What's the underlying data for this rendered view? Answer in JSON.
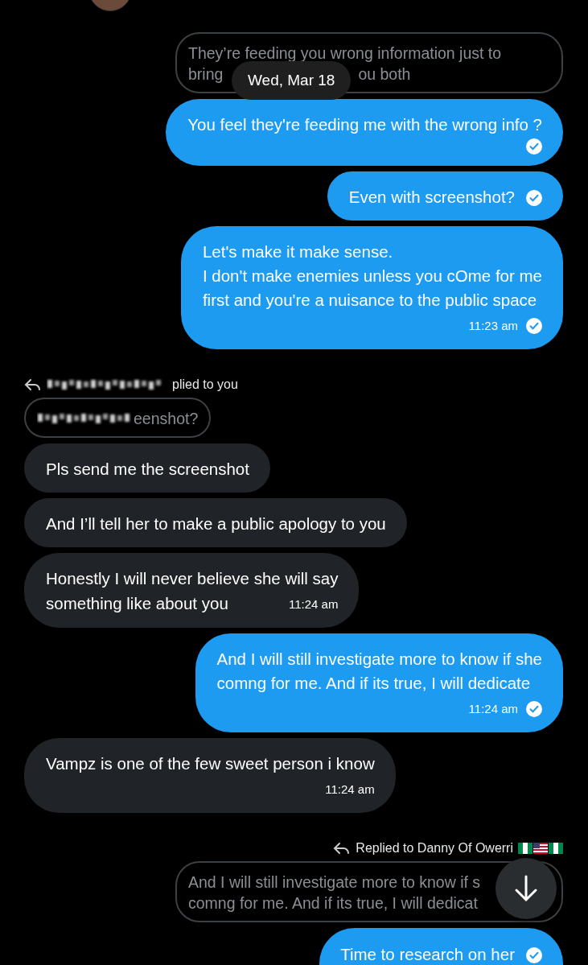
{
  "date_pill": "Wed, Mar 18",
  "messages": [
    {
      "kind": "quote_out",
      "lines": [
        [
          "They’re feeding you wrong information just to"
        ],
        [
          "bring",
          "ou both"
        ]
      ]
    },
    {
      "kind": "sent",
      "lines": [
        "You feel they're feeding me with the wrong info ?"
      ],
      "seen": true
    },
    {
      "kind": "sent",
      "lines": [
        "Even with screenshot?"
      ],
      "seen": true
    },
    {
      "kind": "sent",
      "lines": [
        "Let's make it make sense.",
        "I don't make enemies unless you cOme for me",
        "first and you're a nuisance to the public space"
      ],
      "time": "11:23 am",
      "seen": true
    },
    {
      "kind": "reply_to_you",
      "text": "plied to you"
    },
    {
      "kind": "quote_in",
      "lines": [
        [
          "eenshot?"
        ]
      ]
    },
    {
      "kind": "received",
      "lines": [
        "Pls send me the screenshot"
      ]
    },
    {
      "kind": "received",
      "lines": [
        "And I’ll tell her to make a public apology to you"
      ]
    },
    {
      "kind": "received",
      "lines": [
        "Honestly I will never believe she will say",
        "something like about you"
      ],
      "time": "11:24 am"
    },
    {
      "kind": "sent",
      "lines": [
        "And I will still investigate more to know if she",
        "comng for me. And if its true, I will dedicate"
      ],
      "time": "11:24 am",
      "seen": true
    },
    {
      "kind": "received",
      "lines": [
        "Vampz is one of the few sweet person i know"
      ],
      "time": "11:24 am"
    },
    {
      "kind": "reply_to_them",
      "text": "Replied to Danny Of Owerri",
      "flags": [
        {
          "kind": "nigeria"
        },
        {
          "kind": "usa"
        },
        {
          "kind": "nigeria"
        }
      ]
    },
    {
      "kind": "quote_out",
      "lines": [
        [
          "And I will still investigate more to know if s"
        ],
        [
          "comng for me. And if its true, I will dedicat"
        ]
      ]
    },
    {
      "kind": "sent",
      "lines": [
        "Time to research on her"
      ],
      "seen": true
    }
  ]
}
